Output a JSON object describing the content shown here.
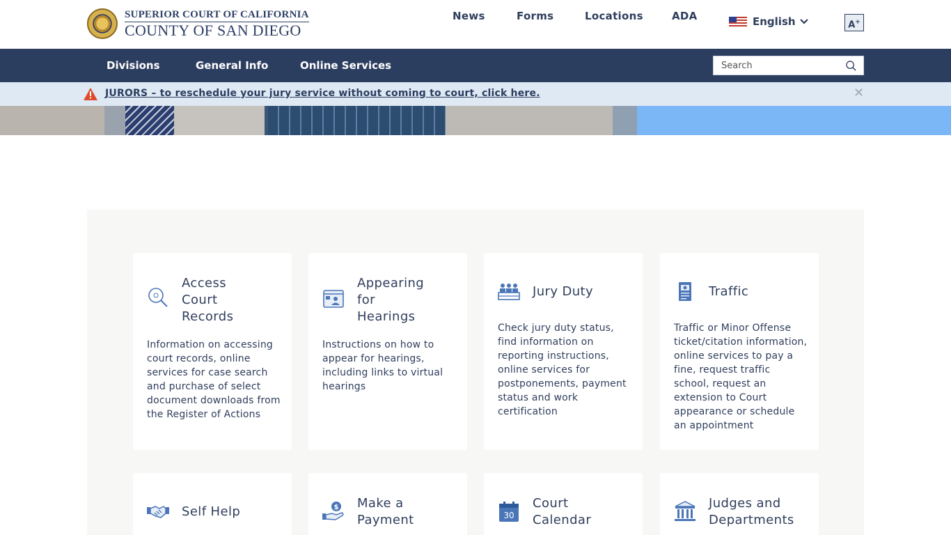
{
  "header": {
    "logo_line1": "SUPERIOR COURT OF CALIFORNIA",
    "logo_line2": "COUNTY OF SAN DIEGO",
    "nav": [
      "News",
      "Forms",
      "Locations",
      "ADA"
    ],
    "language": "English",
    "text_size_button": "A"
  },
  "navbar": {
    "items": [
      "Divisions",
      "General Info",
      "Online Services"
    ],
    "search_placeholder": "Search"
  },
  "alert": {
    "text": "JURORS – to reschedule your jury service without coming to court, click here."
  },
  "cards": [
    {
      "title": "Access Court Records",
      "title_lines": [
        "Access",
        "Court",
        "Records"
      ],
      "icon": "magnifier-icon",
      "description": "Information on accessing court records, online services for case search and purchase of select document downloads from the Register of Actions"
    },
    {
      "title": "Appearing for Hearings",
      "title_lines": [
        "Appearing",
        "for",
        "Hearings"
      ],
      "icon": "virtual-hearing-icon",
      "description": "Instructions on how to appear for hearings, including links to virtual hearings"
    },
    {
      "title": "Jury Duty",
      "title_lines": [
        "Jury Duty"
      ],
      "icon": "jury-box-icon",
      "description": "Check jury duty status, find information on reporting instructions, online services for postponements, payment status and work certification"
    },
    {
      "title": "Traffic",
      "title_lines": [
        "Traffic"
      ],
      "icon": "traffic-ticket-icon",
      "description": "Traffic or Minor Offense ticket/citation information, online services to pay a fine, request traffic school, request an extension to Court appearance or schedule an appointment"
    },
    {
      "title": "Self Help",
      "title_lines": [
        "Self Help"
      ],
      "icon": "handshake-icon",
      "description": ""
    },
    {
      "title": "Make a Payment",
      "title_lines": [
        "Make a",
        "Payment"
      ],
      "icon": "payment-hand-icon",
      "description": ""
    },
    {
      "title": "Court Calendar",
      "title_lines": [
        "Court",
        "Calendar"
      ],
      "icon": "calendar-icon",
      "calendar_number": "30",
      "description": ""
    },
    {
      "title": "Judges and Departments",
      "title_lines": [
        "Judges and",
        "Departments"
      ],
      "icon": "courthouse-icon",
      "description": ""
    }
  ],
  "colors": {
    "navy": "#2c3e60",
    "alert_bg": "#dfe9f3",
    "icon_blue": "#4a76b8",
    "alert_red": "#e04a2c"
  }
}
